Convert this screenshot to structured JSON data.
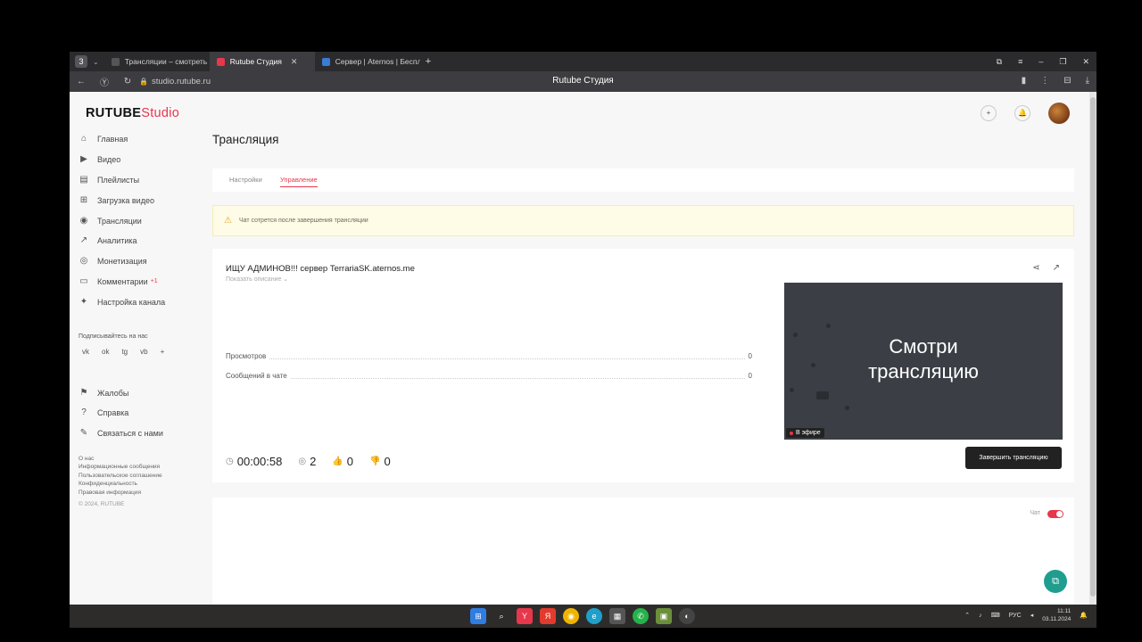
{
  "browser": {
    "tab_count_badge": "3",
    "tabs": [
      {
        "label": "Трансляции – смотреть в",
        "favicon_color": "#333333",
        "active": false
      },
      {
        "label": "Rutube Студия",
        "favicon_color": "#e8364b",
        "active": true
      },
      {
        "label": "Сервер | Aternos | Беспла",
        "favicon_color": "#3a7bd5",
        "active": false
      }
    ],
    "url": "studio.rutube.ru",
    "window_title": "Rutube Студия"
  },
  "header": {
    "logo_main": "RUTUBE",
    "logo_suffix": "Studio"
  },
  "sidebar": {
    "items": [
      {
        "label": "Главная",
        "icon": "home-icon",
        "glyph": "⌂"
      },
      {
        "label": "Видео",
        "icon": "video-icon",
        "glyph": "▶"
      },
      {
        "label": "Плейлисты",
        "icon": "playlist-icon",
        "glyph": "▤"
      },
      {
        "label": "Загрузка видео",
        "icon": "upload-icon",
        "glyph": "⊞"
      },
      {
        "label": "Трансляции",
        "icon": "broadcast-icon",
        "glyph": "◉"
      },
      {
        "label": "Аналитика",
        "icon": "analytics-icon",
        "glyph": "↗"
      },
      {
        "label": "Монетизация",
        "icon": "money-icon",
        "glyph": "◎"
      },
      {
        "label": "Комментарии",
        "icon": "comments-icon",
        "glyph": "▭",
        "badge": "+1"
      },
      {
        "label": "Настройка канала",
        "icon": "wand-icon",
        "glyph": "✦"
      }
    ],
    "subscribe_label": "Подписывайтесь на нас",
    "social": [
      "vk",
      "ok",
      "tg",
      "vb",
      "+"
    ],
    "secondary": [
      {
        "label": "Жалобы",
        "icon": "flag-icon",
        "glyph": "⚑"
      },
      {
        "label": "Справка",
        "icon": "help-icon",
        "glyph": "?"
      },
      {
        "label": "Связаться с нами",
        "icon": "pencil-icon",
        "glyph": "✎"
      }
    ],
    "footer_links": [
      "О нас",
      "Информационные сообщения",
      "Пользовательское соглашение",
      "Конфиденциальность",
      "Правовая информация"
    ],
    "copyright": "© 2024, RUTUBE"
  },
  "main": {
    "title": "Трансляция",
    "tabs": [
      {
        "label": "Настройки",
        "active": false
      },
      {
        "label": "Управление",
        "active": true
      }
    ],
    "warning": "Чат сотрется после завершения трансляции",
    "stream": {
      "title": "ИЩУ АДМИНОВ!!! сервер TerrariaSK.aternos.me",
      "show_description": "Показать описание ⌄",
      "stats": [
        {
          "label": "Просмотров",
          "value": "0"
        },
        {
          "label": "Сообщений в чате",
          "value": "0"
        }
      ],
      "preview_text_line1": "Смотри",
      "preview_text_line2": "трансляцию",
      "live_badge": "В эфире",
      "duration": "00:00:58",
      "viewers": "2",
      "likes": "0",
      "dislikes": "0",
      "end_button": "Завершить трансляцию"
    },
    "chat": {
      "label": "Чат",
      "enabled": true
    }
  },
  "taskbar": {
    "lang": "РУС",
    "time": "11:11",
    "date": "03.11.2024"
  },
  "colors": {
    "accent": "#e8364b",
    "button_dark": "#222222",
    "warning_bg": "#fefbe7",
    "fab": "#1f9e8f"
  }
}
